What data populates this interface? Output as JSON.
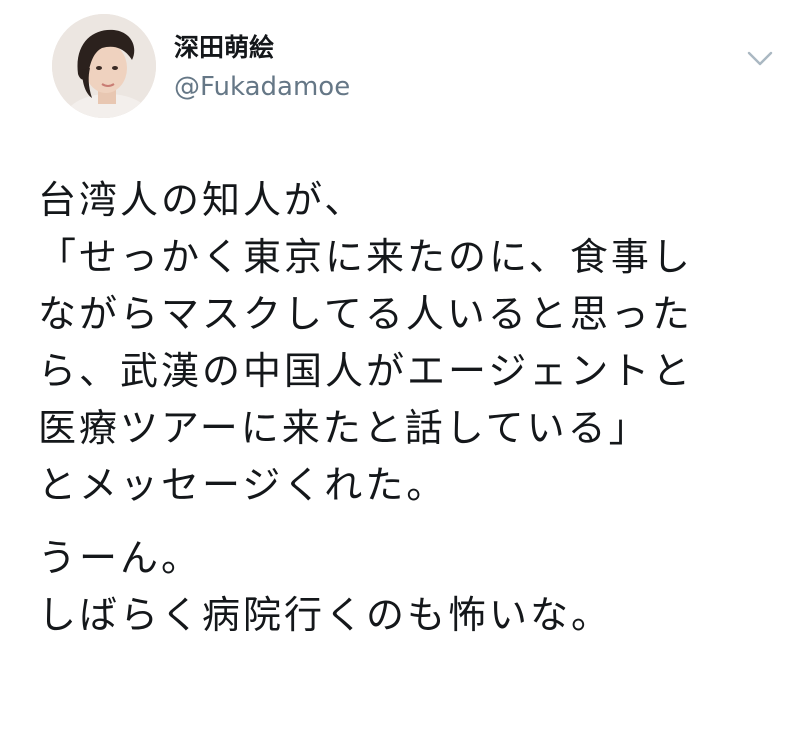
{
  "author": {
    "display_name": "深田萌絵",
    "handle": "@Fukadamoe",
    "avatar_icon": "profile-photo"
  },
  "menu": {
    "icon": "chevron-down-icon"
  },
  "tweet": {
    "paragraph1": [
      "台湾人の知人が、",
      "「せっかく東京に来たのに、食事し",
      "ながらマスクしてる人いると思った",
      "ら、武漢の中国人がエージェントと",
      "医療ツアーに来たと話している」",
      "とメッセージくれた。"
    ],
    "paragraph2": [
      "うーん。",
      "しばらく病院行くのも怖いな。"
    ]
  },
  "colors": {
    "text": "#14171a",
    "secondary": "#657786",
    "chevron": "#aab8c2"
  }
}
